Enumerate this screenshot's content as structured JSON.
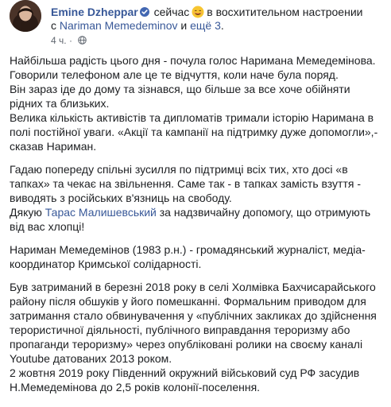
{
  "post": {
    "author_name": "Emine Dzheppar",
    "feeling_text": "сейчас",
    "feeling_rest": "в восхитительном настроении",
    "with_prefix": "с",
    "tagged_person": "Nariman Memedeminov",
    "and_word": "и",
    "others_link": "ещё 3",
    "period": ".",
    "timestamp": "4 ч.",
    "separator": "·",
    "icons": {
      "verified": "verified-badge-icon",
      "feeling": "smiling-face-emoji-icon",
      "privacy": "globe-icon",
      "avatar": "profile-photo"
    },
    "colors": {
      "link": "#385898",
      "text": "#1c1e21",
      "meta": "#606770",
      "verified": "#4267b2"
    }
  },
  "body": {
    "p1": [
      "Найбільша радість цього дня - почула голос Наримана Мемедемінова.",
      "Говорили телефоном але це те відчуття, коли наче була поряд.",
      "Він зараз іде до дому та зізнався, що більше за все хоче обійняти рідних та близьких.",
      "Велика кількість активістів та дипломатів тримали історію Наримана в полі постійної уваги. «Акції та кампанії на підтримку дуже допомогли»,- сказав Нариман."
    ],
    "p2": "Гадаю попереду спільні зусилля по підтримці всіх тих, хто досі «в тапках» та чекає на звільнення. Саме так - в тапках замість взуття - виводять з російських в'язниць на свободу.",
    "p3_prefix": "Дякую",
    "p3_mention": "Тарас Малишевський",
    "p3_suffix": "за надзвичайну допомогу, що отримують від вас хлопці!",
    "p4": "Нариман Мемедемінов (1983 р.н.) - громадянський журналіст, медіа-координатор Кримської солідарності.",
    "p5": "Був затриманий в березні 2018 року в селі Холмівка Бахчисарайського району після обшуків у його помешканні. Формальним приводом для затримання стало обвинувачення у «публічних закликах до здійснення терористичної діяльності, публічного виправдання тероризму або пропаганди тероризму» через опубліковані ролики на своєму каналі Youtube датованих 2013 роком.",
    "p6": "2 жовтня 2019 року Південний окружний військовий суд РФ засудив Н.Мемедемінова до 2,5 років колонії-поселення."
  }
}
